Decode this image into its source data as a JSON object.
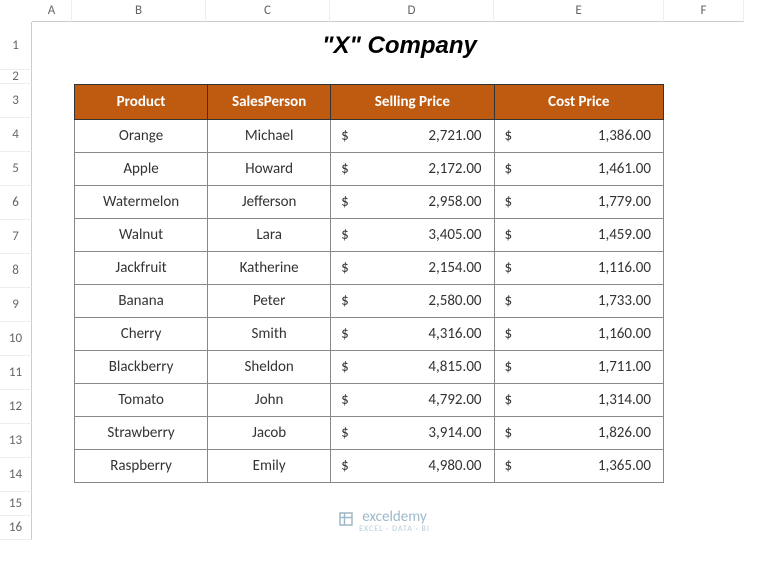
{
  "columns": [
    "A",
    "B",
    "C",
    "D",
    "E",
    "F"
  ],
  "rows": [
    "1",
    "2",
    "3",
    "4",
    "5",
    "6",
    "7",
    "8",
    "9",
    "10",
    "11",
    "12",
    "13",
    "14",
    "15",
    "16"
  ],
  "title": "\"X\" Company",
  "headers": {
    "product": "Product",
    "salesperson": "SalesPerson",
    "selling_price": "Selling Price",
    "cost_price": "Cost Price"
  },
  "rows_data": [
    {
      "product": "Orange",
      "salesperson": "Michael",
      "selling": "2,721.00",
      "cost": "1,386.00"
    },
    {
      "product": "Apple",
      "salesperson": "Howard",
      "selling": "2,172.00",
      "cost": "1,461.00"
    },
    {
      "product": "Watermelon",
      "salesperson": "Jefferson",
      "selling": "2,958.00",
      "cost": "1,779.00"
    },
    {
      "product": "Walnut",
      "salesperson": "Lara",
      "selling": "3,405.00",
      "cost": "1,459.00"
    },
    {
      "product": "Jackfruit",
      "salesperson": "Katherine",
      "selling": "2,154.00",
      "cost": "1,116.00"
    },
    {
      "product": "Banana",
      "salesperson": "Peter",
      "selling": "2,580.00",
      "cost": "1,733.00"
    },
    {
      "product": "Cherry",
      "salesperson": "Smith",
      "selling": "4,316.00",
      "cost": "1,160.00"
    },
    {
      "product": "Blackberry",
      "salesperson": "Sheldon",
      "selling": "4,815.00",
      "cost": "1,711.00"
    },
    {
      "product": "Tomato",
      "salesperson": "John",
      "selling": "4,792.00",
      "cost": "1,314.00"
    },
    {
      "product": "Strawberry",
      "salesperson": "Jacob",
      "selling": "3,914.00",
      "cost": "1,826.00"
    },
    {
      "product": "Raspberry",
      "salesperson": "Emily",
      "selling": "4,980.00",
      "cost": "1,365.00"
    }
  ],
  "currency_symbol": "$",
  "watermark": {
    "name": "exceldemy",
    "sub": "EXCEL · DATA · BI"
  },
  "chart_data": {
    "type": "table",
    "title": "\"X\" Company",
    "columns": [
      "Product",
      "SalesPerson",
      "Selling Price",
      "Cost Price"
    ],
    "data": [
      [
        "Orange",
        "Michael",
        2721.0,
        1386.0
      ],
      [
        "Apple",
        "Howard",
        2172.0,
        1461.0
      ],
      [
        "Watermelon",
        "Jefferson",
        2958.0,
        1779.0
      ],
      [
        "Walnut",
        "Lara",
        3405.0,
        1459.0
      ],
      [
        "Jackfruit",
        "Katherine",
        2154.0,
        1116.0
      ],
      [
        "Banana",
        "Peter",
        2580.0,
        1733.0
      ],
      [
        "Cherry",
        "Smith",
        4316.0,
        1160.0
      ],
      [
        "Blackberry",
        "Sheldon",
        4815.0,
        1711.0
      ],
      [
        "Tomato",
        "John",
        4792.0,
        1314.0
      ],
      [
        "Strawberry",
        "Jacob",
        3914.0,
        1826.0
      ],
      [
        "Raspberry",
        "Emily",
        4980.0,
        1365.0
      ]
    ]
  }
}
